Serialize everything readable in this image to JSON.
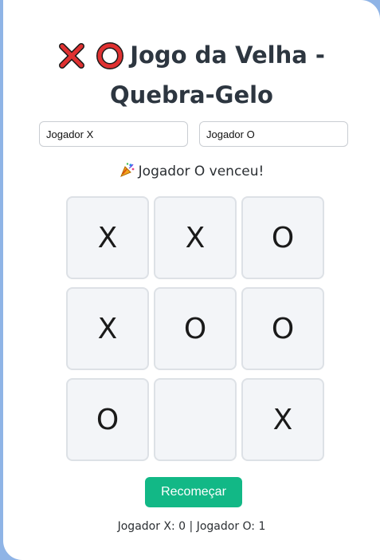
{
  "app": {
    "title": "Jogo da Velha - Quebra-Gelo"
  },
  "icons": {
    "title_icons": [
      "cross-mark-icon",
      "hollow-circle-icon"
    ],
    "status_icon": "party-popper-icon"
  },
  "inputs": {
    "player_x_value": "Jogador X",
    "player_o_value": "Jogador O"
  },
  "status": {
    "text": "Jogador O venceu!"
  },
  "board": {
    "cells": [
      "X",
      "X",
      "O",
      "X",
      "O",
      "O",
      "O",
      "",
      "X"
    ]
  },
  "controls": {
    "restart_label": "Recomeçar"
  },
  "score": {
    "text": "Jogador X: 0 | Jogador O: 1"
  },
  "colors": {
    "background": "#8fb4e6",
    "card": "#ffffff",
    "accent_button": "#12b886",
    "cell_bg": "#f3f5f8",
    "cell_border": "#dde1e6",
    "title_text": "#2d3640",
    "icon_red": "#e03131"
  }
}
